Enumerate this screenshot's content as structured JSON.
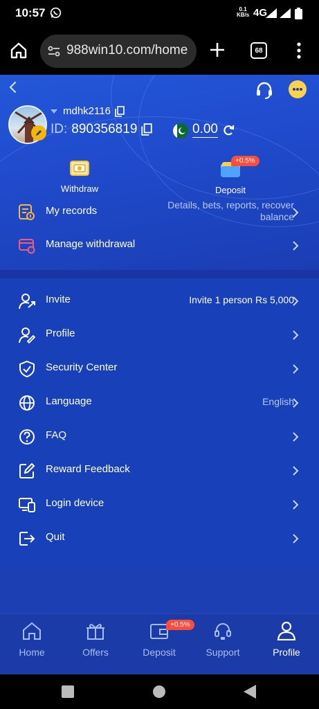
{
  "status_bar": {
    "time": "10:57",
    "net_speed_value": "0.1",
    "net_speed_unit": "KB/s",
    "network": "4G",
    "icons": [
      "whatsapp-icon",
      "signal-icon",
      "battery-icon"
    ]
  },
  "browser": {
    "url": "988win10.com/home",
    "tab_count": "68"
  },
  "header": {
    "username": "mdhk2116",
    "id_label": "ID:",
    "id_value": "890356819",
    "balance": "0.00"
  },
  "actions": {
    "withdraw_label": "Withdraw",
    "deposit_label": "Deposit",
    "deposit_badge": "+0.5%"
  },
  "records": {
    "my_records_label": "My records",
    "my_records_value_line1": "Details, bets, reports, recover",
    "my_records_value_line2": "balance",
    "manage_withdrawal_label": "Manage withdrawal"
  },
  "menu": {
    "invite_label": "Invite",
    "invite_value": "Invite 1 person Rs 5,000",
    "profile_label": "Profile",
    "security_label": "Security Center",
    "language_label": "Language",
    "language_value": "English",
    "faq_label": "FAQ",
    "reward_label": "Reward Feedback",
    "login_device_label": "Login device",
    "quit_label": "Quit"
  },
  "bottom_nav": {
    "home": "Home",
    "offers": "Offers",
    "deposit": "Deposit",
    "deposit_badge": "+0.5%",
    "support": "Support",
    "profile": "Profile",
    "active": "profile"
  },
  "colors": {
    "primary_blue": "#1a3cae",
    "accent_yellow": "#fcd34a",
    "badge_red": "#ff4d3a"
  }
}
